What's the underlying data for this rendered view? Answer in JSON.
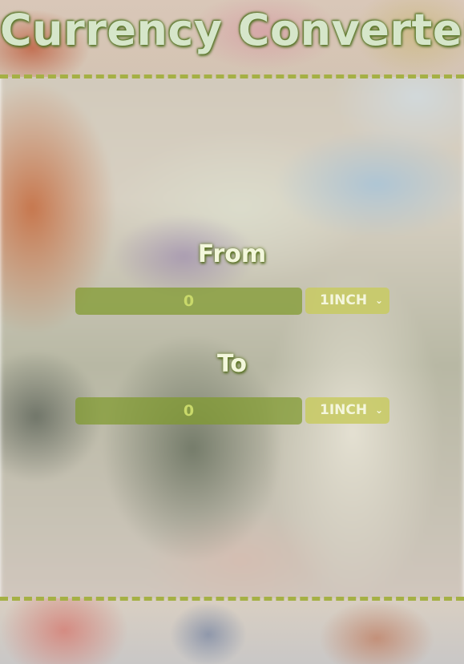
{
  "app": {
    "title": "Currency Converter"
  },
  "from": {
    "label": "From",
    "amount": "0",
    "currency": "1INCH"
  },
  "to": {
    "label": "To",
    "amount": "0",
    "currency": "1INCH"
  },
  "icons": {
    "dropdown": "chevron-down-icon"
  },
  "colors": {
    "accent": "#a5b045",
    "input_background": "#809a2c",
    "select_background": "#c8ca62",
    "title_text": "#d6e6ca",
    "title_shadow": "#4c6b21"
  }
}
